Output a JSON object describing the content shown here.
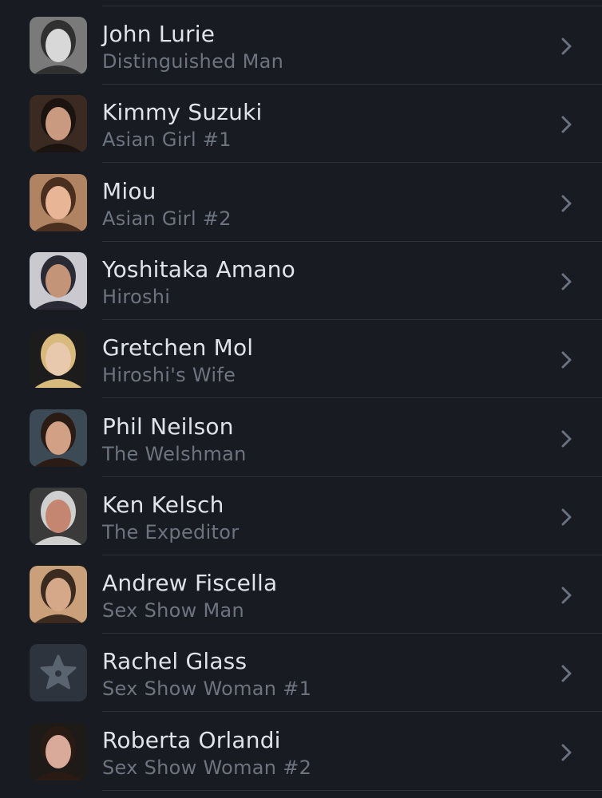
{
  "cast": [
    {
      "name": "John Lurie",
      "role": "Distinguished Man",
      "avatar": "person-photo-icon",
      "tone": [
        "#7a7a7a",
        "#d8d8d8",
        "#303030"
      ]
    },
    {
      "name": "Kimmy Suzuki",
      "role": "Asian Girl #1",
      "avatar": "person-photo-icon",
      "tone": [
        "#3a2a22",
        "#c99a80",
        "#1a1310"
      ]
    },
    {
      "name": "Miou",
      "role": "Asian Girl #2",
      "avatar": "person-photo-icon",
      "tone": [
        "#b08462",
        "#e8b697",
        "#4a2e1e"
      ]
    },
    {
      "name": "Yoshitaka Amano",
      "role": "Hiroshi",
      "avatar": "person-photo-icon",
      "tone": [
        "#c9c9cf",
        "#c49479",
        "#2a2a34"
      ]
    },
    {
      "name": "Gretchen Mol",
      "role": "Hiroshi's Wife",
      "avatar": "person-photo-icon",
      "tone": [
        "#1c1c1c",
        "#e9c9ae",
        "#d8bb7c"
      ]
    },
    {
      "name": "Phil Neilson",
      "role": "The Welshman",
      "avatar": "person-photo-icon",
      "tone": [
        "#3c4a55",
        "#d2a085",
        "#2a1c14"
      ]
    },
    {
      "name": "Ken Kelsch",
      "role": "The Expeditor",
      "avatar": "person-photo-icon",
      "tone": [
        "#3a3a3a",
        "#c48670",
        "#cfcfcf"
      ]
    },
    {
      "name": "Andrew Fiscella",
      "role": "Sex Show Man",
      "avatar": "person-photo-icon",
      "tone": [
        "#c9a079",
        "#d6a88a",
        "#3a2a20"
      ]
    },
    {
      "name": "Rachel Glass",
      "role": "Sex Show Woman #1",
      "avatar": "star-placeholder-icon",
      "tone": [
        "#2e343d",
        "#5a6470",
        "#2e343d"
      ]
    },
    {
      "name": "Roberta Orlandi",
      "role": "Sex Show Woman #2",
      "avatar": "person-photo-icon",
      "tone": [
        "#1e1a18",
        "#d9a99a",
        "#2a1a14"
      ]
    }
  ],
  "chevron_icon": "chevron-right-icon"
}
